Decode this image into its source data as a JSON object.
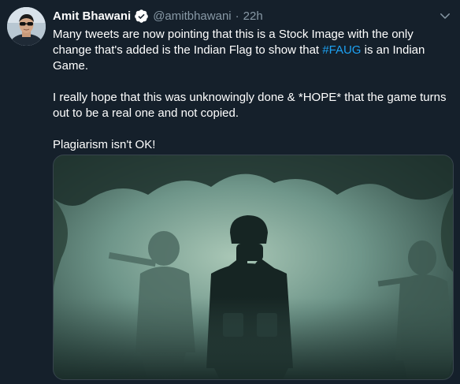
{
  "tweet": {
    "author": {
      "display_name": "Amit Bhawani",
      "handle": "@amitbhawani",
      "verified": true,
      "avatar_icon": "user-avatar"
    },
    "separator": "·",
    "timestamp": "22h",
    "body": {
      "line1_before_hashtag": "Many tweets are now pointing that this is a Stock Image with the only change that's added is the Indian Flag to show that ",
      "hashtag": "#FAUG",
      "line1_after_hashtag": " is an Indian Game.",
      "paragraph2": "I really hope that this was unknowingly done & *HOPE* that the game turns out to be a real one and not copied.",
      "paragraph3": "Plagiarism isn't OK!"
    },
    "media": {
      "kind": "photo",
      "subject": "soldiers-in-smoke"
    }
  },
  "colors": {
    "background": "#15202b",
    "text": "#ffffff",
    "secondary_text": "#8899a6",
    "link": "#1da1f2",
    "verified_badge": "#ffffff"
  }
}
